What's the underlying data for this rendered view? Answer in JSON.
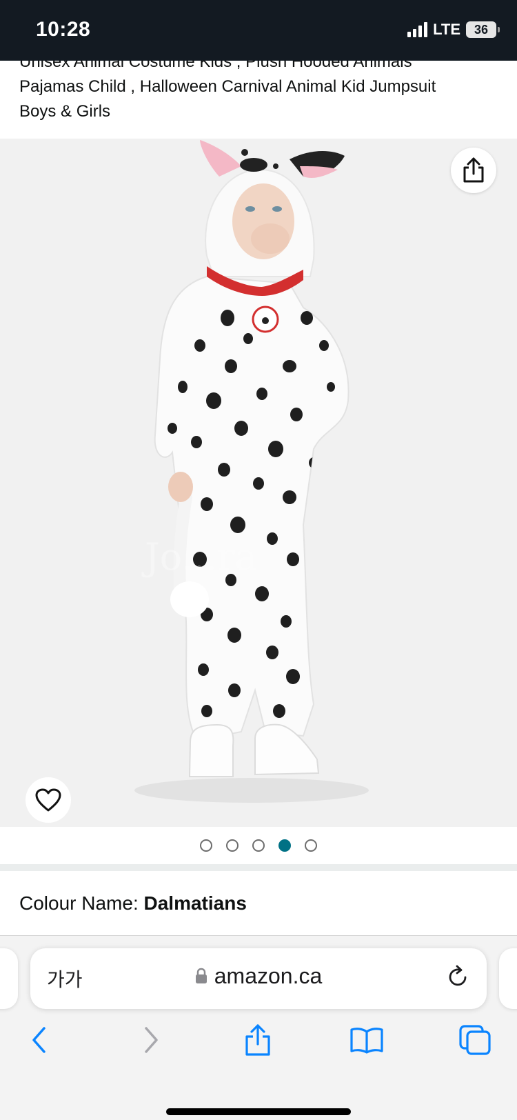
{
  "status_bar": {
    "time": "10:28",
    "network": "LTE",
    "battery": "36"
  },
  "product": {
    "title_lines": [
      "Unisex Animal Costume Kids , Plush Hooded Animals",
      "Pajamas Child , Halloween Carnival Animal Kid Jumpsuit",
      "Boys & Girls"
    ],
    "image_watermark": "Jo...ra",
    "image_pager": {
      "count": 5,
      "active_index": 3
    },
    "colour_label": "Colour Name:",
    "colour_value": "Dalmatians"
  },
  "icons": {
    "share": "share-icon",
    "wishlist": "heart-icon",
    "lock": "lock-icon",
    "reload": "reload-icon",
    "back": "chevron-left-icon",
    "forward": "chevron-right-icon",
    "browser_share": "share-icon",
    "bookmarks": "book-icon",
    "tabs": "tabs-icon"
  },
  "browser": {
    "text_size_label": "가가",
    "url": "amazon.ca"
  },
  "colors": {
    "accent_teal": "#007185",
    "ios_blue": "#0a84ff",
    "status_bar_bg": "#131a22"
  }
}
